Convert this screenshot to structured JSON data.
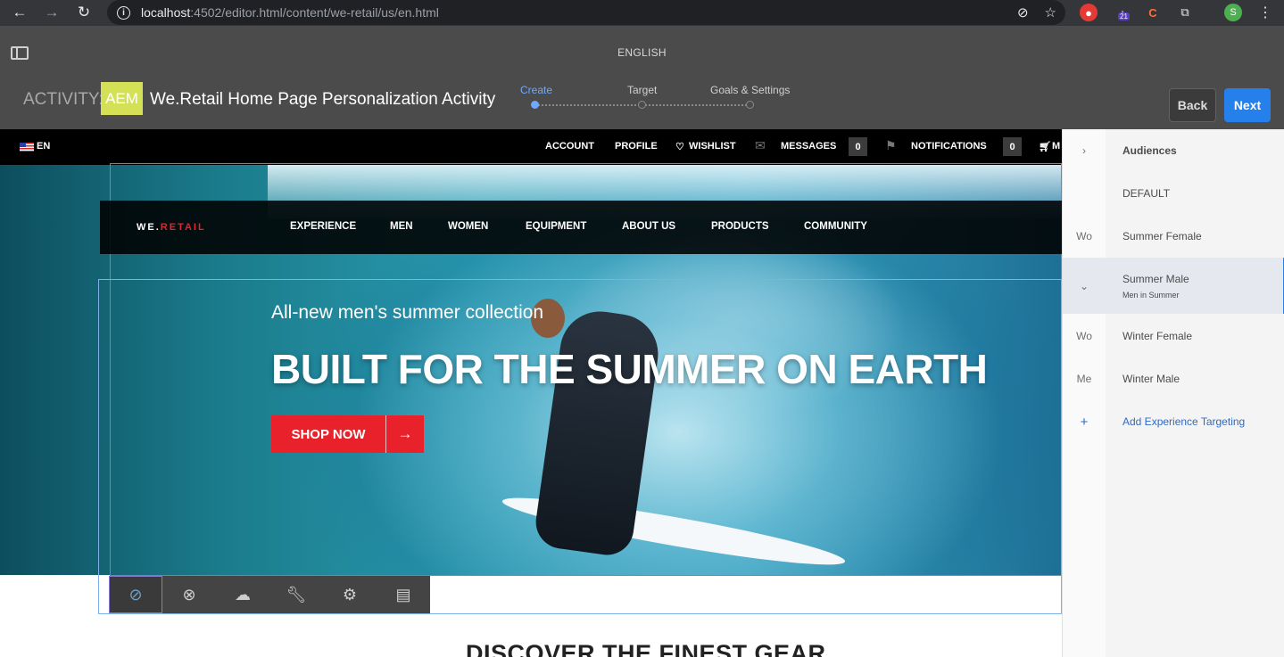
{
  "browser": {
    "url_host": "localhost",
    "url_path": ":4502/editor.html/content/we-retail/us/en.html",
    "back_icon": "arrow-left-icon",
    "forward_icon": "arrow-right-icon",
    "reload_icon": "reload-icon",
    "ext_badge_count": "21",
    "profile_initial": "S"
  },
  "editor": {
    "language_title": "ENGLISH",
    "activity_label": "ACTIVITY:",
    "brand_badge": "AEM",
    "activity_name": "We.Retail Home Page Personalization Activity",
    "steps": [
      {
        "label": "Create",
        "active": true
      },
      {
        "label": "Target",
        "active": false
      },
      {
        "label": "Goals & Settings",
        "active": false
      }
    ],
    "back_label": "Back",
    "next_label": "Next",
    "accent_color": "#2680eb"
  },
  "site": {
    "lang": "EN",
    "top_links": {
      "account": "ACCOUNT",
      "profile": "PROFILE",
      "wishlist": "WISHLIST",
      "messages": "MESSAGES",
      "messages_count": "0",
      "notifications": "NOTIFICATIONS",
      "notifications_count": "0",
      "cart_partial": "M"
    },
    "brand_prefix": "WE.",
    "brand_suffix": "RETAIL",
    "nav": [
      "EXPERIENCE",
      "MEN",
      "WOMEN",
      "EQUIPMENT",
      "ABOUT US",
      "PRODUCTS",
      "COMMUNITY"
    ],
    "hero_subtitle": "All-new men's summer collection",
    "hero_title": "BUILT FOR THE SUMMER ON EARTH",
    "shop_label": "SHOP NOW",
    "discover_title": "DISCOVER THE FINEST GEAR",
    "brand_red": "#e8212b"
  },
  "toolbar": {
    "tools": [
      "disable-icon",
      "close-circle-icon",
      "upload-cloud-icon",
      "wrench-icon",
      "gear-icon",
      "table-icon"
    ]
  },
  "panel": {
    "header": "Audiences",
    "rows": [
      {
        "gutter": "",
        "label": "DEFAULT",
        "sub": ""
      },
      {
        "gutter": "Wo",
        "label": "Summer Female",
        "sub": ""
      },
      {
        "gutter": "⌄",
        "label": "Summer Male",
        "sub": "Men in Summer"
      },
      {
        "gutter": "Wo",
        "label": "Winter Female",
        "sub": ""
      },
      {
        "gutter": "Me",
        "label": "Winter Male",
        "sub": ""
      },
      {
        "gutter": "+",
        "label": "Add Experience Targeting",
        "sub": ""
      }
    ]
  }
}
